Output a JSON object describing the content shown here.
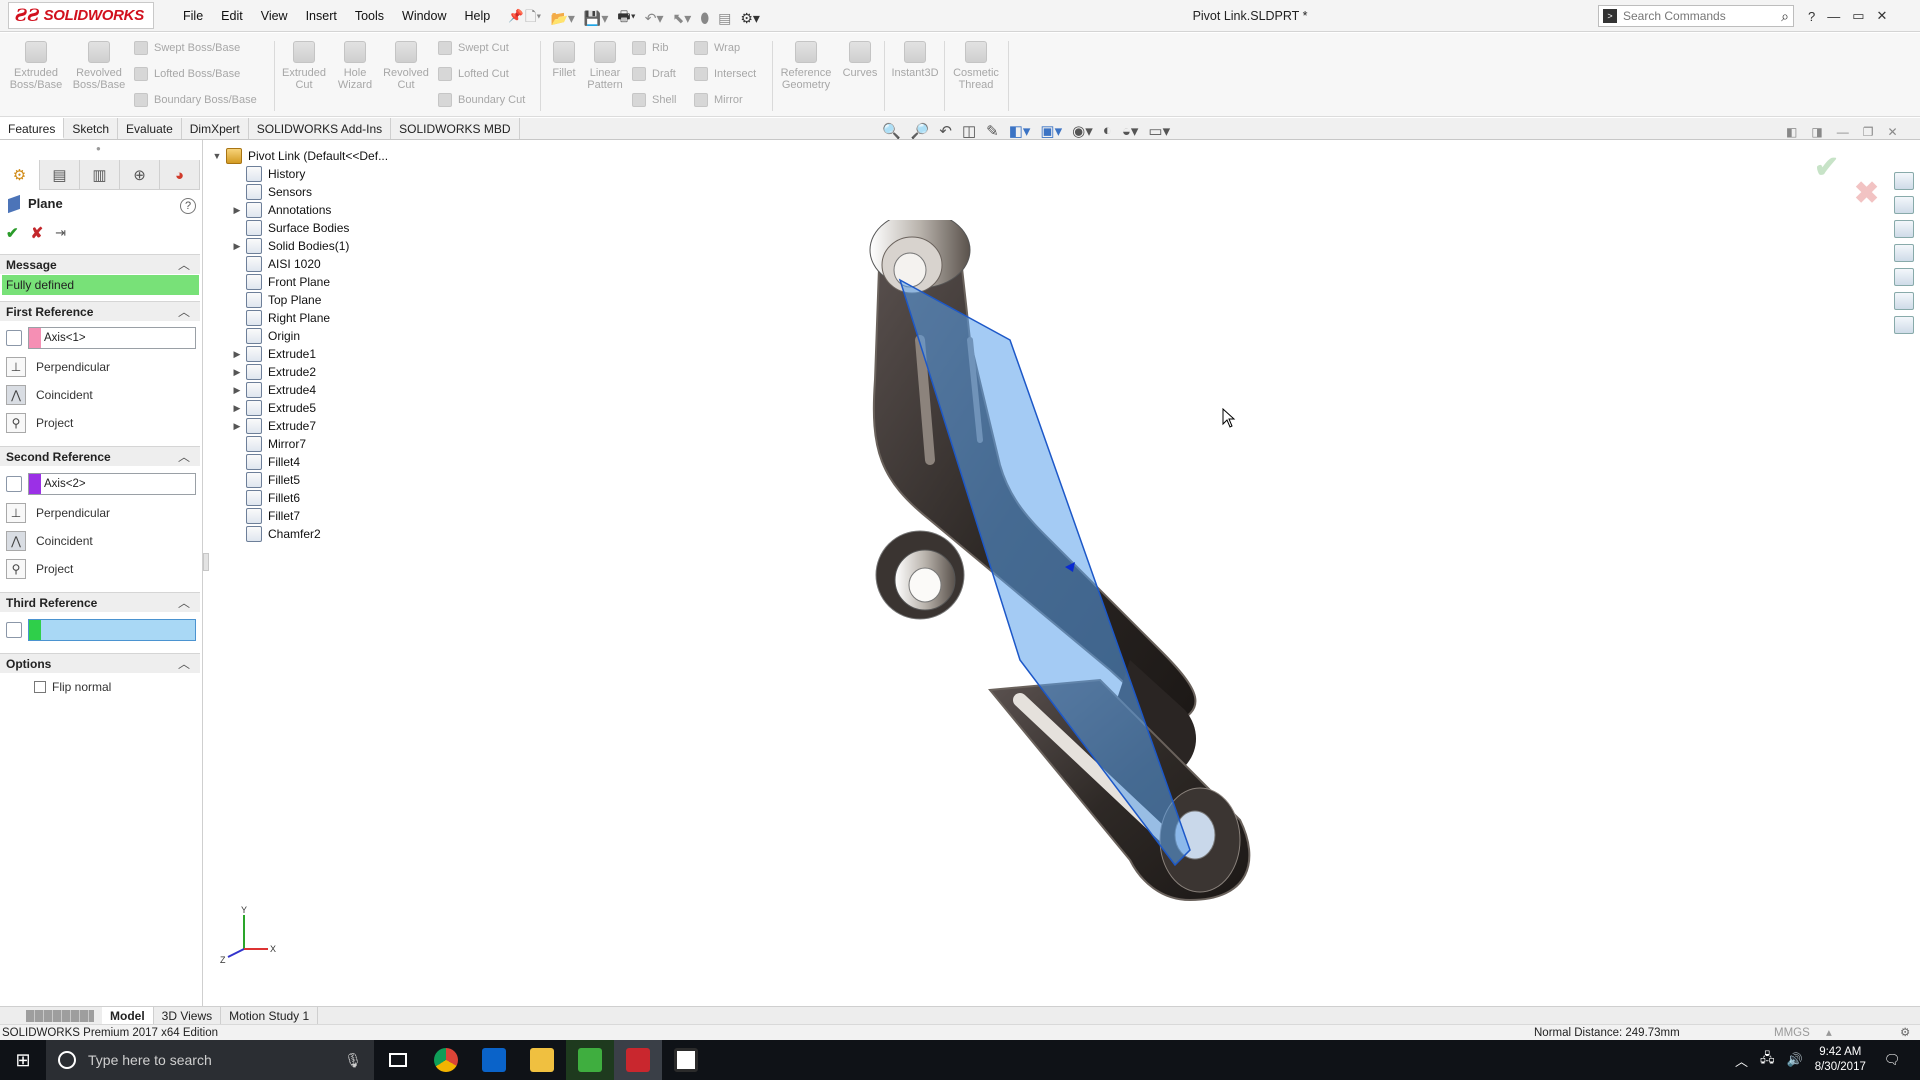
{
  "app": {
    "logo_text": "SOLIDWORKS",
    "menu": [
      "File",
      "Edit",
      "View",
      "Insert",
      "Tools",
      "Window",
      "Help"
    ],
    "document_title": "Pivot Link.SLDPRT *",
    "search_placeholder": "Search Commands",
    "window_controls": [
      "?",
      "—",
      "▭",
      "✕"
    ]
  },
  "command_manager": {
    "large_tools": [
      {
        "label1": "Extruded",
        "label2": "Boss/Base"
      },
      {
        "label1": "Revolved",
        "label2": "Boss/Base"
      },
      {
        "label1": "Extruded",
        "label2": "Cut"
      },
      {
        "label1": "Hole",
        "label2": "Wizard"
      },
      {
        "label1": "Revolved",
        "label2": "Cut"
      },
      {
        "label1": "Fillet",
        "label2": ""
      },
      {
        "label1": "Linear",
        "label2": "Pattern"
      },
      {
        "label1": "Reference",
        "label2": "Geometry"
      },
      {
        "label1": "Curves",
        "label2": ""
      },
      {
        "label1": "Instant3D",
        "label2": ""
      },
      {
        "label1": "Cosmetic",
        "label2": "Thread"
      }
    ],
    "small_tools": [
      "Swept Boss/Base",
      "Lofted Boss/Base",
      "Boundary Boss/Base",
      "Swept Cut",
      "Lofted Cut",
      "Boundary Cut",
      "Rib",
      "Draft",
      "Shell",
      "Wrap",
      "Intersect",
      "Mirror"
    ]
  },
  "tabs": [
    "Features",
    "Sketch",
    "Evaluate",
    "DimXpert",
    "SOLIDWORKS Add-Ins",
    "SOLIDWORKS MBD"
  ],
  "property_manager": {
    "title": "Plane",
    "help": "?",
    "message_header": "Message",
    "message": "Fully defined",
    "first_reference": {
      "header": "First Reference",
      "value": "Axis<1>",
      "color": "#f58fb4",
      "options": [
        "Perpendicular",
        "Coincident",
        "Project"
      ]
    },
    "second_reference": {
      "header": "Second Reference",
      "value": "Axis<2>",
      "color": "#9b30e6",
      "options": [
        "Perpendicular",
        "Coincident",
        "Project"
      ]
    },
    "third_reference": {
      "header": "Third Reference",
      "value": "",
      "color": "#2fcf4a"
    },
    "options": {
      "header": "Options",
      "flip_normal": "Flip normal"
    }
  },
  "feature_tree": [
    {
      "label": "Pivot Link  (Default<<Def...",
      "expander": "▼",
      "icon": "part-icon"
    },
    {
      "label": "History",
      "expander": "",
      "icon": "history-icon"
    },
    {
      "label": "Sensors",
      "expander": "",
      "icon": "sensor-icon"
    },
    {
      "label": "Annotations",
      "expander": "▶",
      "icon": "annotations-icon"
    },
    {
      "label": "Surface Bodies",
      "expander": "",
      "icon": "surface-bodies-icon"
    },
    {
      "label": "Solid Bodies(1)",
      "expander": "▶",
      "icon": "solid-bodies-icon"
    },
    {
      "label": "AISI 1020",
      "expander": "",
      "icon": "material-icon"
    },
    {
      "label": "Front Plane",
      "expander": "",
      "icon": "plane-icon"
    },
    {
      "label": "Top Plane",
      "expander": "",
      "icon": "plane-icon"
    },
    {
      "label": "Right Plane",
      "expander": "",
      "icon": "plane-icon"
    },
    {
      "label": "Origin",
      "expander": "",
      "icon": "origin-icon"
    },
    {
      "label": "Extrude1",
      "expander": "▶",
      "icon": "extrude-icon"
    },
    {
      "label": "Extrude2",
      "expander": "▶",
      "icon": "extrude-icon"
    },
    {
      "label": "Extrude4",
      "expander": "▶",
      "icon": "extrude-icon"
    },
    {
      "label": "Extrude5",
      "expander": "▶",
      "icon": "extrude-icon"
    },
    {
      "label": "Extrude7",
      "expander": "▶",
      "icon": "extrude-icon"
    },
    {
      "label": "Mirror7",
      "expander": "",
      "icon": "mirror-icon"
    },
    {
      "label": "Fillet4",
      "expander": "",
      "icon": "fillet-icon"
    },
    {
      "label": "Fillet5",
      "expander": "",
      "icon": "fillet-icon"
    },
    {
      "label": "Fillet6",
      "expander": "",
      "icon": "fillet-icon"
    },
    {
      "label": "Fillet7",
      "expander": "",
      "icon": "fillet-icon"
    },
    {
      "label": "Chamfer2",
      "expander": "",
      "icon": "chamfer-icon"
    }
  ],
  "bottom_tabs": [
    "Model",
    "3D Views",
    "Motion Study 1"
  ],
  "status": {
    "edition": "SOLIDWORKS Premium 2017 x64 Edition",
    "measure": "Normal Distance: 249.73mm",
    "units": "MMGS"
  },
  "taskbar": {
    "search_placeholder": "Type here to search",
    "time": "9:42 AM",
    "date": "8/30/2017"
  },
  "triad": {
    "x": "X",
    "y": "Y",
    "z": "Z"
  }
}
